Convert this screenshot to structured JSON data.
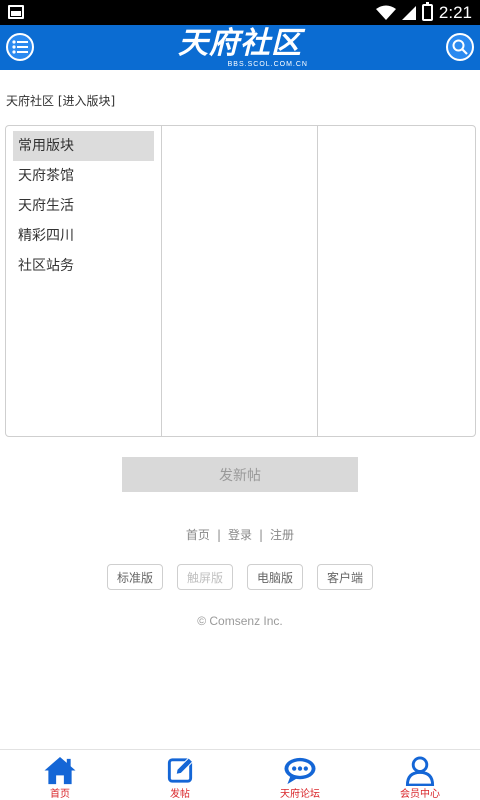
{
  "status_bar": {
    "time": "2:21",
    "icons": [
      "image-icon",
      "wifi-icon",
      "signal-icon",
      "battery-icon"
    ]
  },
  "header": {
    "logo_text": "天府社区",
    "logo_sub": "BBS.SCOL.COM.CN",
    "left_button_icon": "list-menu-icon",
    "right_button_icon": "search-icon",
    "accent_color": "#0b6cd2"
  },
  "breadcrumb": "天府社区 [进入版块]",
  "categories": [
    {
      "label": "常用版块",
      "active": true
    },
    {
      "label": "天府茶馆",
      "active": false
    },
    {
      "label": "天府生活",
      "active": false
    },
    {
      "label": "精彩四川",
      "active": false
    },
    {
      "label": "社区站务",
      "active": false
    }
  ],
  "post_button": "发新帖",
  "footer_links": [
    "首页",
    "登录",
    "注册"
  ],
  "footer_sep": "|",
  "versions": [
    {
      "label": "标准版",
      "disabled": false
    },
    {
      "label": "触屏版",
      "disabled": true
    },
    {
      "label": "电脑版",
      "disabled": false
    },
    {
      "label": "客户端",
      "disabled": false
    }
  ],
  "copyright": "© Comsenz Inc.",
  "bottom_nav": [
    {
      "label": "首页",
      "icon": "home-icon"
    },
    {
      "label": "发帖",
      "icon": "compose-icon"
    },
    {
      "label": "天府论坛",
      "icon": "chat-bubble-icon"
    },
    {
      "label": "会员中心",
      "icon": "user-icon"
    }
  ],
  "colors": {
    "header_blue": "#0b6cd2",
    "nav_icon_blue": "#1466d6",
    "nav_label_red": "#d9262a"
  }
}
